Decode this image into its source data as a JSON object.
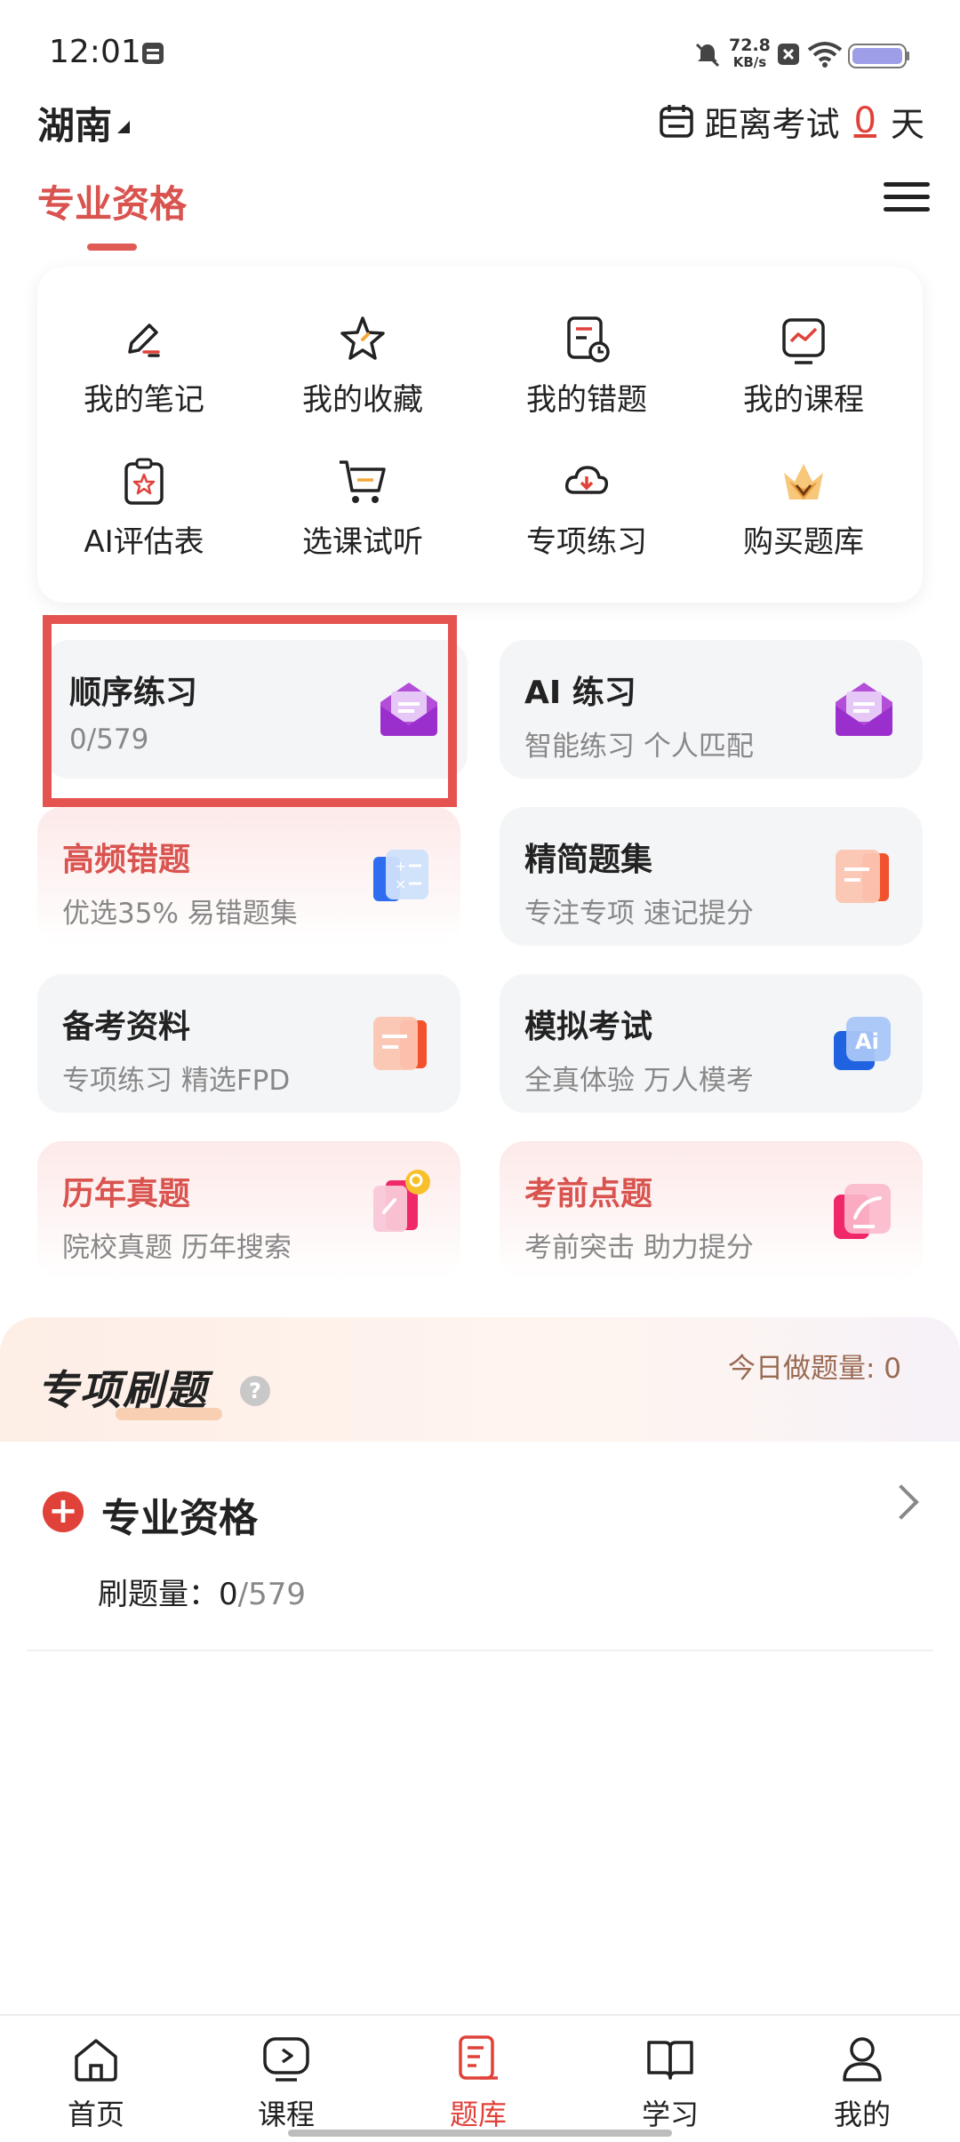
{
  "status": {
    "time": "12:01",
    "speed_value": "72.8",
    "speed_unit": "KB/s"
  },
  "header": {
    "region": "湖南",
    "exam_prefix": "距离考试",
    "exam_days": "0",
    "exam_suffix": "天",
    "tab_title": "专业资格"
  },
  "quick_access": [
    {
      "label": "我的笔记",
      "icon": "note-edit-icon"
    },
    {
      "label": "我的收藏",
      "icon": "star-icon"
    },
    {
      "label": "我的错题",
      "icon": "wrong-question-icon"
    },
    {
      "label": "我的课程",
      "icon": "course-chart-icon"
    },
    {
      "label": "AI评估表",
      "icon": "clipboard-star-icon"
    },
    {
      "label": "选课试听",
      "icon": "cart-icon"
    },
    {
      "label": "专项练习",
      "icon": "cloud-download-icon"
    },
    {
      "label": "购买题库",
      "icon": "crown-icon"
    }
  ],
  "practice_cards": [
    {
      "title": "顺序练习",
      "subtitle": "0/579",
      "icon": "purple-envelope-icon"
    },
    {
      "title": "AI 练习",
      "subtitle": "智能练习 个人匹配",
      "icon": "purple-envelope-icon"
    },
    {
      "title": "高频错题",
      "subtitle": "优选35% 易错题集",
      "icon": "calculator-icon"
    },
    {
      "title": "精简题集",
      "subtitle": "专注专项 速记提分",
      "icon": "orange-list-icon"
    },
    {
      "title": "备考资料",
      "subtitle": "专项练习 精选FPD",
      "icon": "orange-list-icon"
    },
    {
      "title": "模拟考试",
      "subtitle": "全真体验 万人模考",
      "icon": "ai-badge-icon"
    },
    {
      "title": "历年真题",
      "subtitle": "院校真题 历年搜索",
      "icon": "search-book-icon"
    },
    {
      "title": "考前点题",
      "subtitle": "考前突击 助力提分",
      "icon": "pen-card-icon"
    }
  ],
  "special": {
    "title": "专项刷题",
    "today_label": "今日做题量: 0",
    "category_title": "专业资格",
    "progress_label": "刷题量：",
    "progress_done": "0",
    "progress_total": "/579"
  },
  "nav": [
    {
      "label": "首页",
      "icon": "home-icon"
    },
    {
      "label": "课程",
      "icon": "play-icon"
    },
    {
      "label": "题库",
      "icon": "question-bank-icon"
    },
    {
      "label": "学习",
      "icon": "book-icon"
    },
    {
      "label": "我的",
      "icon": "user-icon"
    }
  ],
  "colors": {
    "accent": "#e0423a",
    "highlight": "#e55350",
    "pink_bg": "#fde9e9",
    "card_bg": "#f4f5f7"
  }
}
